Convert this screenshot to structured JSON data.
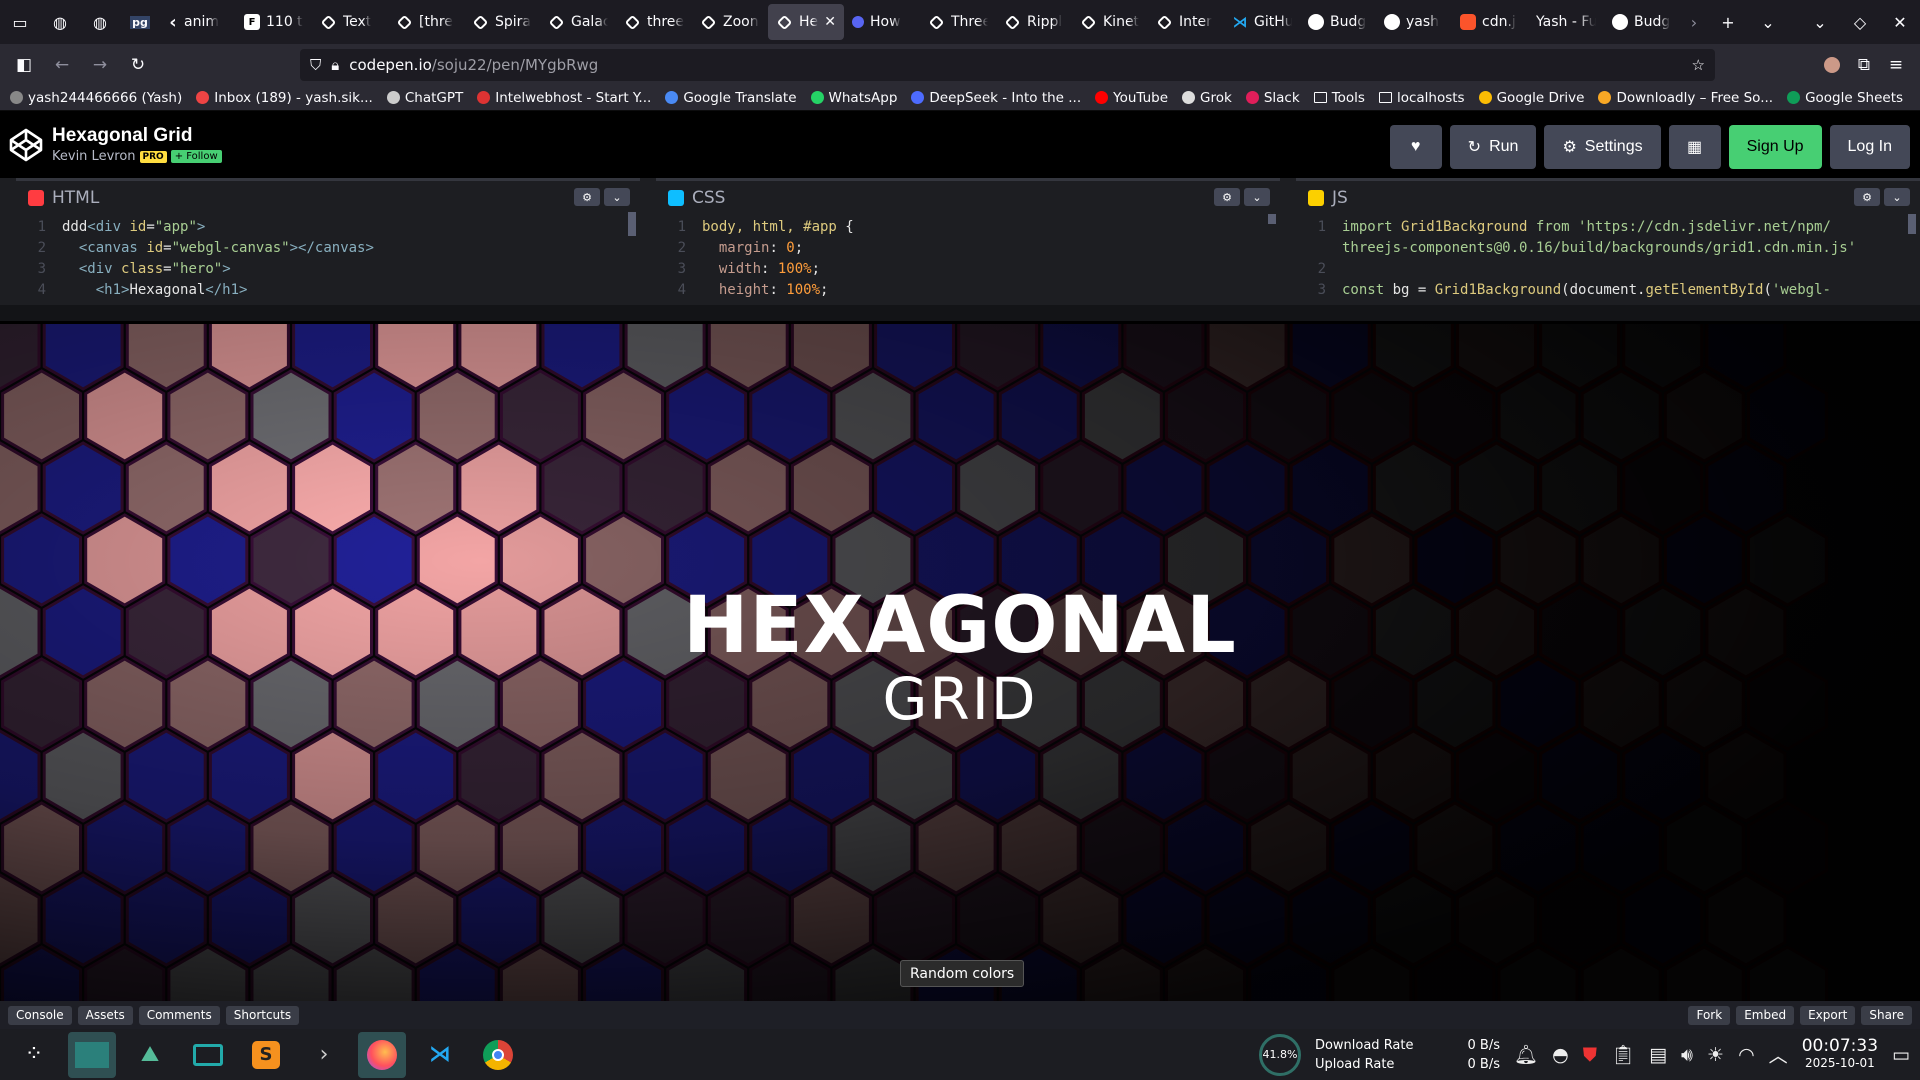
{
  "browser": {
    "tabs": [
      {
        "label": "anim",
        "icon": "back-chevron-icon"
      },
      {
        "label": "110 t",
        "icon": "f-icon"
      },
      {
        "label": "Text",
        "icon": "codepen-icon"
      },
      {
        "label": "[thre",
        "icon": "codepen-icon"
      },
      {
        "label": "Spira",
        "icon": "codepen-icon"
      },
      {
        "label": "Galac",
        "icon": "codepen-icon"
      },
      {
        "label": "three",
        "icon": "codepen-icon"
      },
      {
        "label": "Zoon",
        "icon": "codepen-icon"
      },
      {
        "label": "He",
        "icon": "codepen-icon",
        "active": true
      },
      {
        "label": "How",
        "icon": "dot-icon"
      },
      {
        "label": "Three",
        "icon": "codepen-icon"
      },
      {
        "label": "Rippl",
        "icon": "codepen-icon"
      },
      {
        "label": "Kinet",
        "icon": "codepen-icon"
      },
      {
        "label": "Inter",
        "icon": "codepen-icon"
      },
      {
        "label": "GitHu",
        "icon": "vscode-icon"
      },
      {
        "label": "Budg",
        "icon": "github-icon"
      },
      {
        "label": "yash",
        "icon": "github-icon"
      },
      {
        "label": "cdn.j",
        "icon": "brave-icon"
      },
      {
        "label": "Yash - Fu",
        "icon": "none"
      },
      {
        "label": "Budg",
        "icon": "github-icon"
      }
    ],
    "url_host": "codepen.io",
    "url_path": "/soju22/pen/MYgbRwg",
    "bookmarks": [
      {
        "label": "yash244466666 (Yash)",
        "color": "#888"
      },
      {
        "label": "Inbox (189) - yash.sik...",
        "color": "#e44"
      },
      {
        "label": "ChatGPT",
        "color": "#ccc"
      },
      {
        "label": "Intelwebhost - Start Y...",
        "color": "#d33"
      },
      {
        "label": "Google Translate",
        "color": "#4a8af4"
      },
      {
        "label": "WhatsApp",
        "color": "#25d366"
      },
      {
        "label": "DeepSeek - Into the ...",
        "color": "#4d6bfe"
      },
      {
        "label": "YouTube",
        "color": "#f00"
      },
      {
        "label": "Grok",
        "color": "#ddd"
      },
      {
        "label": "Slack",
        "color": "#e01e5a"
      },
      {
        "label": "Tools",
        "color": "folder"
      },
      {
        "label": "localhosts",
        "color": "folder"
      },
      {
        "label": "Google Drive",
        "color": "#fbbc04"
      },
      {
        "label": "Downloadly – Free So...",
        "color": "#f9a825"
      },
      {
        "label": "Google Sheets",
        "color": "#0f9d58"
      }
    ]
  },
  "codepen": {
    "title": "Hexagonal Grid",
    "author": "Kevin Levron",
    "pro_badge": "PRO",
    "follow_label": "+ Follow",
    "buttons": {
      "run": "Run",
      "settings": "Settings",
      "signup": "Sign Up",
      "login": "Log In"
    },
    "editors": {
      "html": {
        "label": "HTML",
        "color": "#ff3c41"
      },
      "css": {
        "label": "CSS",
        "color": "#0ebeff"
      },
      "js": {
        "label": "JS",
        "color": "#fcd000"
      }
    },
    "hero": {
      "title": "HEXAGONAL",
      "subtitle": "GRID"
    },
    "random_colors": "Random colors",
    "footer": {
      "left": [
        "Console",
        "Assets",
        "Comments",
        "Shortcuts"
      ],
      "right": [
        "Fork",
        "Embed",
        "Export",
        "Share"
      ]
    }
  },
  "taskbar": {
    "cpu": "41.8%",
    "download_label": "Download Rate",
    "upload_label": "Upload Rate",
    "download_value": "0 B/s",
    "upload_value": "0 B/s",
    "time": "00:07:33",
    "date": "2025-10-01"
  }
}
